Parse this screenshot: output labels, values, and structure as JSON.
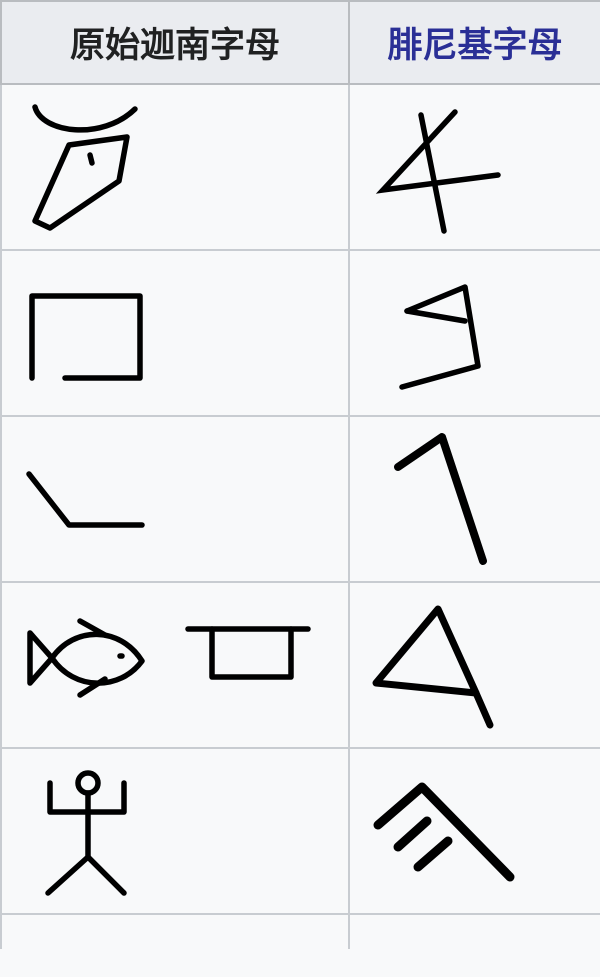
{
  "table": {
    "headers": {
      "proto_sinaitic": "原始迦南字母",
      "phoenician": "腓尼基字母"
    },
    "rows": [
      {
        "proto_glyph": "ox-head-glyph",
        "phoenician_glyph": "aleph-glyph"
      },
      {
        "proto_glyph": "house-glyph",
        "phoenician_glyph": "beth-glyph"
      },
      {
        "proto_glyph": "throwstick-glyph",
        "phoenician_glyph": "gimel-glyph"
      },
      {
        "proto_glyph": [
          "fish-glyph",
          "door-glyph"
        ],
        "phoenician_glyph": "daleth-glyph"
      },
      {
        "proto_glyph": "jubilating-man-glyph",
        "phoenician_glyph": "he-glyph"
      }
    ]
  }
}
